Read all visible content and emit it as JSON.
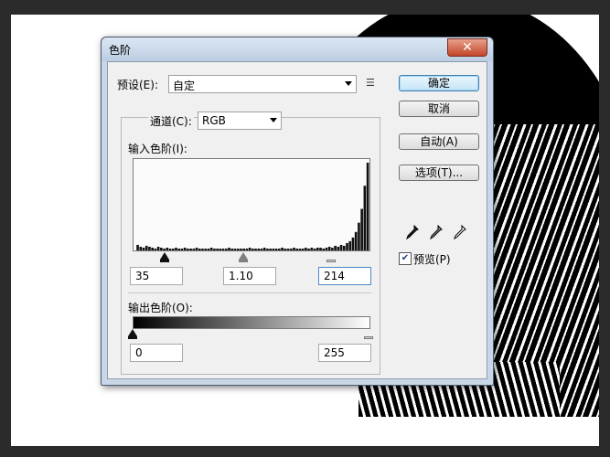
{
  "dialog": {
    "title": "色阶",
    "close_glyph": "✕"
  },
  "preset": {
    "label": "预设(E):",
    "value": "自定"
  },
  "channel": {
    "label": "通道(C):",
    "value": "RGB"
  },
  "input_levels": {
    "label": "输入色阶(I):",
    "black": "35",
    "gamma": "1.10",
    "white": "214",
    "black_fraction": 0.137,
    "gamma_fraction": 0.47,
    "white_fraction": 0.84
  },
  "output_levels": {
    "label": "输出色阶(O):",
    "black": "0",
    "white": "255"
  },
  "buttons": {
    "ok": "确定",
    "cancel": "取消",
    "auto": "自动(A)",
    "options": "选项(T)..."
  },
  "preview": {
    "label": "预览(P)",
    "checked": true
  },
  "icons": {
    "menu": "list-menu-icon",
    "eyedroppers": [
      "black-eyedropper-icon",
      "gray-eyedropper-icon",
      "white-eyedropper-icon"
    ]
  },
  "histogram": {
    "values": [
      0,
      6,
      4,
      3,
      5,
      4,
      3,
      2,
      4,
      3,
      2,
      3,
      2,
      2,
      3,
      2,
      2,
      3,
      2,
      2,
      2,
      3,
      2,
      2,
      2,
      2,
      3,
      2,
      2,
      2,
      2,
      2,
      3,
      2,
      2,
      2,
      2,
      2,
      2,
      3,
      2,
      2,
      2,
      2,
      3,
      2,
      2,
      2,
      2,
      2,
      3,
      2,
      2,
      2,
      3,
      2,
      2,
      2,
      3,
      2,
      3,
      2,
      3,
      3,
      2,
      3,
      4,
      3,
      5,
      4,
      6,
      5,
      8,
      10,
      14,
      20,
      30,
      45,
      70,
      95
    ]
  }
}
